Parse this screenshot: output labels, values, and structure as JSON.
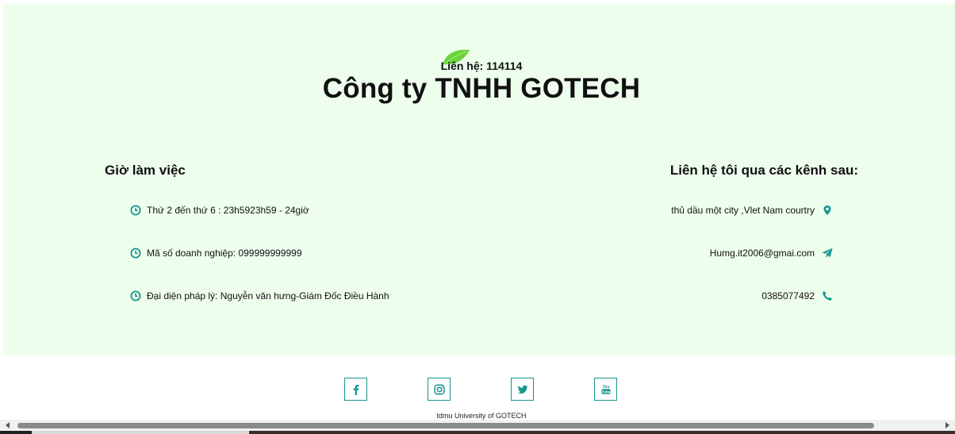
{
  "header": {
    "hotline": "Liên hệ: 114114",
    "company": "Công ty TNHH GOTECH"
  },
  "hours": {
    "title": "Giờ làm việc",
    "items": [
      {
        "icon": "clock-icon",
        "text": "Thứ 2 đến thứ 6 : 23h5923h59 - 24giờ"
      },
      {
        "icon": "clock-icon",
        "text": "Mã số doanh nghiệp: 099999999999"
      },
      {
        "icon": "clock-icon",
        "text": "Đại diện pháp lý: Nguyễn văn hưng-Giám Đốc Điều Hành"
      }
    ]
  },
  "contact": {
    "title": "Liên hệ tôi qua các kênh sau:",
    "items": [
      {
        "icon": "map-marker-icon",
        "text": "thủ dầu một city ,Vlet Nam courtry"
      },
      {
        "icon": "paper-plane-icon",
        "text": "Humg.it2006@gmai.com"
      },
      {
        "icon": "phone-icon",
        "text": "0385077492"
      }
    ]
  },
  "social": {
    "facebook": "facebook-icon",
    "instagram": "instagram-icon",
    "twitter": "twitter-icon",
    "youtube": "youtube-icon"
  },
  "footer": {
    "text": "tdmu University of GOTECH"
  },
  "colors": {
    "accent": "#16968d",
    "background": "#eefeed",
    "leaf": "#6ad43b"
  }
}
